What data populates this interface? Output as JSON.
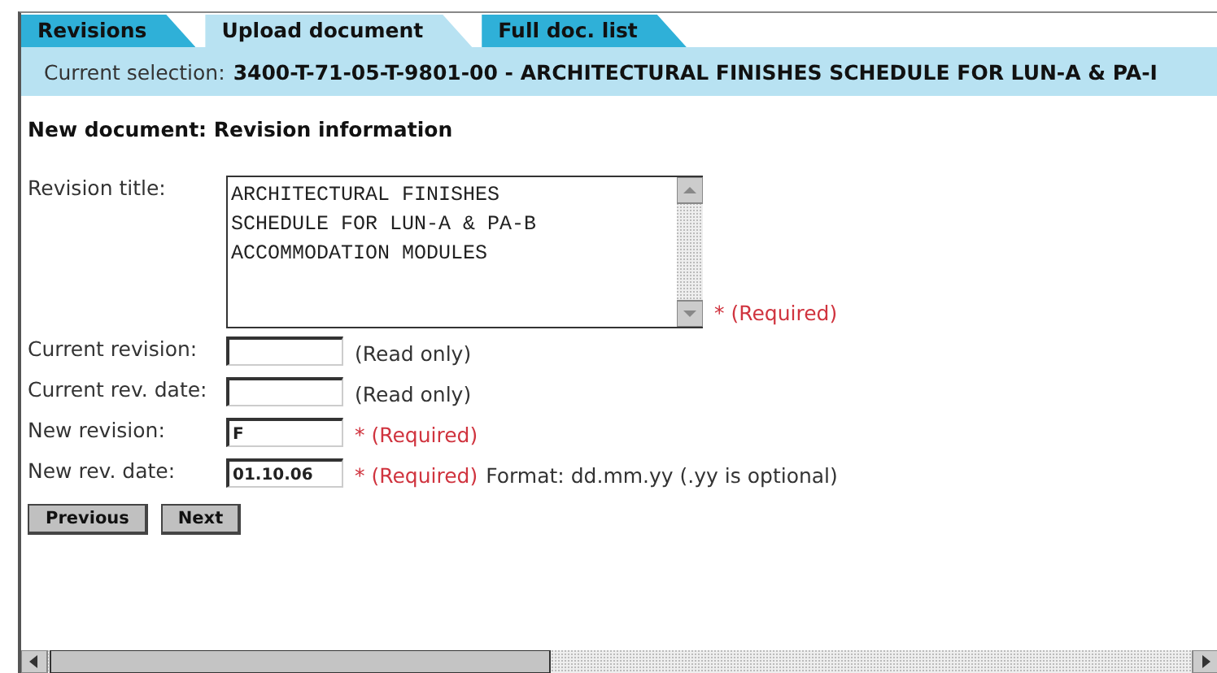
{
  "tabs": [
    {
      "label": "Revisions",
      "selected": false
    },
    {
      "label": "Upload document",
      "selected": true
    },
    {
      "label": "Full doc. list",
      "selected": false
    }
  ],
  "selection": {
    "label": "Current selection:",
    "value": "3400-T-71-05-T-9801-00 - ARCHITECTURAL FINISHES SCHEDULE FOR LUN-A & PA-I"
  },
  "heading": "New document: Revision information",
  "fields": [
    {
      "kind": "textarea",
      "label": "Revision title:",
      "value": "ARCHITECTURAL FINISHES\nSCHEDULE FOR LUN-A & PA-B\nACCOMMODATION MODULES",
      "note": "* (Required)",
      "required": true
    },
    {
      "kind": "text",
      "label": "Current revision:",
      "note": "(Read only)",
      "required": false
    },
    {
      "kind": "text",
      "label": "Current rev. date:",
      "note": "(Read only)",
      "required": false
    },
    {
      "kind": "text",
      "label": "New revision:",
      "value": "F",
      "note": "* (Required)",
      "required": true
    },
    {
      "kind": "text",
      "label": "New rev. date:",
      "value": "01.10.06",
      "note": "* (Required)",
      "required": true,
      "hint": "Format: dd.mm.yy (.yy is optional)"
    }
  ],
  "buttons": [
    "Previous",
    "Next"
  ]
}
